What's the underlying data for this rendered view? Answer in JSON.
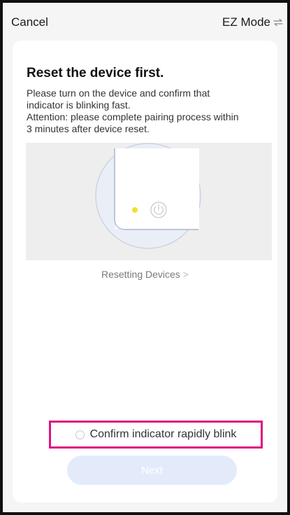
{
  "header": {
    "cancel_label": "Cancel",
    "mode_label": "EZ Mode",
    "mode_icon": "swap-arrows-icon"
  },
  "main": {
    "title": "Reset the device first.",
    "description_lines": [
      "Please turn on the device and confirm that",
      "indicator is blinking fast.",
      "Attention: please complete pairing process within",
      "3 minutes after device reset."
    ],
    "illustration": {
      "indicator_color": "#f2e12c",
      "icons": [
        "device-corner-illustration",
        "power-icon",
        "indicator-light-icon"
      ]
    },
    "reset_link_label": "Resetting Devices",
    "reset_link_chevron": ">",
    "confirm_label": "Confirm indicator rapidly blink",
    "confirm_checked": false,
    "next_label": "Next",
    "next_enabled": false
  },
  "colors": {
    "highlight_border": "#e0117f",
    "next_button_bg": "#e3ebfb",
    "frame_bg": "#f5f5f5",
    "card_bg": "#ffffff"
  }
}
